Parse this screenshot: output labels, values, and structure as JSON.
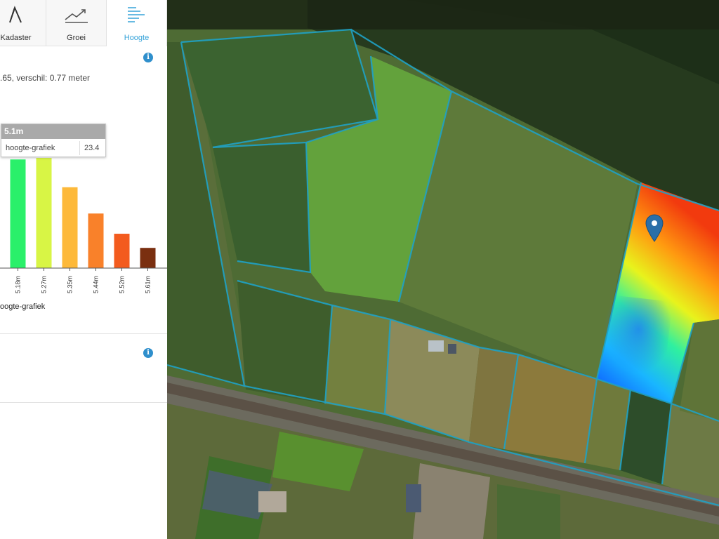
{
  "tabs": [
    {
      "label": "Kadaster",
      "icon": "kadaster-icon"
    },
    {
      "label": "Groei",
      "icon": "growth-chart-icon"
    },
    {
      "label": "Hoogte",
      "icon": "height-lines-icon"
    }
  ],
  "active_tab": "Hoogte",
  "summary_text": ".65, verschil: 0.77 meter",
  "tooltip": {
    "title": "5.1m",
    "series": "hoogte-grafiek",
    "value": "23.4"
  },
  "legend_label": "oogte-grafiek",
  "colors": {
    "accent": "#36a3d9",
    "info": "#2f8fcc"
  },
  "chart_data": {
    "type": "bar",
    "categories": [
      "5.1m",
      "5.18m",
      "5.27m",
      "5.35m",
      "5.44m",
      "5.52m",
      "5.61m"
    ],
    "series": [
      {
        "name": "hoogte-grafiek",
        "values": [
          23.4,
          21.5,
          21.8,
          16.0,
          10.8,
          6.8,
          4.0
        ]
      }
    ],
    "colors": [
      "#22e060",
      "#2af06a",
      "#d8f545",
      "#fdb93a",
      "#f9812a",
      "#f35b1e",
      "#7a2f10"
    ],
    "ylim": [
      0,
      25
    ]
  },
  "map": {
    "marker": "map-pin-icon"
  }
}
